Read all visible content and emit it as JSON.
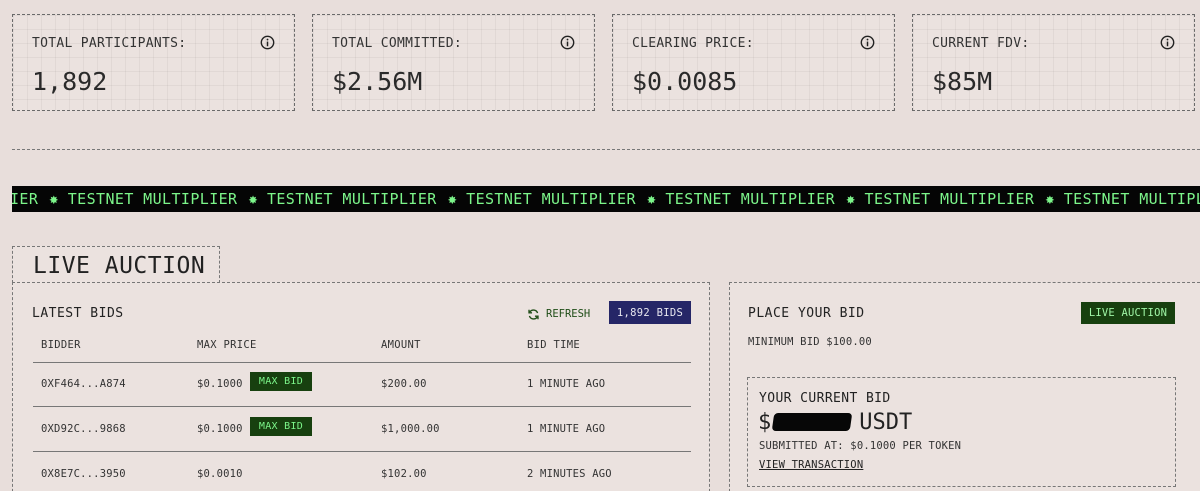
{
  "stats": [
    {
      "label": "TOTAL PARTICIPANTS:",
      "value": "1,892",
      "icon": "info-icon"
    },
    {
      "label": "TOTAL COMMITTED:",
      "value": "$2.56M",
      "icon": "info-icon"
    },
    {
      "label": "CLEARING PRICE:",
      "value": "$0.0085",
      "icon": "info-icon"
    },
    {
      "label": "CURRENT FDV:",
      "value": "$85M",
      "icon": "info-icon"
    }
  ],
  "ticker": {
    "lead_fragment": "IER",
    "text": "TESTNET MULTIPLIER",
    "separator": "✸",
    "trail_fragment": "TES",
    "repeat_count": 6,
    "colors": {
      "background": "#050505",
      "text": "#7cf58a"
    }
  },
  "auction": {
    "tab_label": "LIVE AUCTION",
    "latest_bids": {
      "title": "LATEST BIDS",
      "refresh_label": "REFRESH",
      "refresh_icon": "refresh-icon",
      "bids_count": "1,892 BIDS",
      "columns": [
        "BIDDER",
        "MAX PRICE",
        "AMOUNT",
        "BID TIME"
      ],
      "rows": [
        {
          "bidder": "0XF464...A874",
          "max_price": "$0.1000",
          "badge": "MAX BID",
          "amount": "$200.00",
          "bid_time": "1 MINUTE AGO"
        },
        {
          "bidder": "0XD92C...9868",
          "max_price": "$0.1000",
          "badge": "MAX BID",
          "amount": "$1,000.00",
          "bid_time": "1 MINUTE AGO"
        },
        {
          "bidder": "0X8E7C...3950",
          "max_price": "$0.0010",
          "badge": "",
          "amount": "$102.00",
          "bid_time": "2 MINUTES AGO"
        }
      ]
    },
    "place_bid": {
      "title": "PLACE YOUR BID",
      "status_badge": "LIVE AUCTION",
      "minimum_bid": "MINIMUM BID $100.00",
      "current_bid": {
        "title": "YOUR CURRENT BID",
        "currency_symbol": "$",
        "currency": "USDT",
        "submitted": "SUBMITTED AT: $0.1000 PER TOKEN",
        "link_label": "VIEW TRANSACTION"
      }
    }
  },
  "colors": {
    "page_bg": "#e8dedb",
    "badge_green": "#17400f",
    "badge_green_text": "#7cf58a",
    "bids_count_bg": "#252667",
    "refresh_green": "#1f4d17"
  }
}
